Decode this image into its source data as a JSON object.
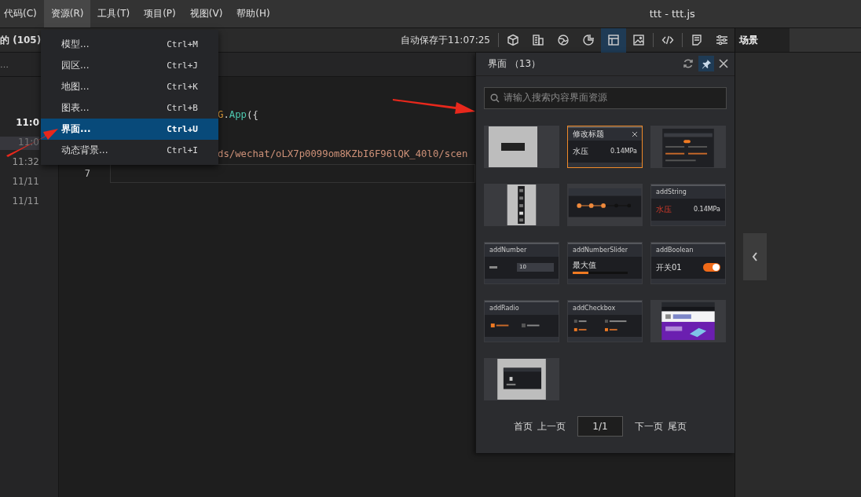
{
  "window": {
    "title": "ttt - ttt.js"
  },
  "menu_bar": [
    {
      "label": "代码(C)",
      "selected": false
    },
    {
      "label": "资源(R)",
      "selected": true
    },
    {
      "label": "工具(T)",
      "selected": false
    },
    {
      "label": "项目(P)",
      "selected": false
    },
    {
      "label": "视图(V)",
      "selected": false
    },
    {
      "label": "帮助(H)",
      "selected": false
    }
  ],
  "left_panel": {
    "title": "的 (105)",
    "placeholder": "…",
    "history": [
      {
        "time": "11:0",
        "selected": false
      },
      {
        "time": "11:0",
        "selected": true
      },
      {
        "time": "11:32",
        "selected": false
      },
      {
        "time": "11/11",
        "selected": false
      },
      {
        "time": "11/11",
        "selected": false
      }
    ]
  },
  "toolbar": {
    "autosave": "自动保存于11:07:25",
    "tools": [
      {
        "kind": "cube",
        "selected": false
      },
      {
        "kind": "building",
        "selected": false
      },
      {
        "kind": "globe",
        "selected": false
      },
      {
        "kind": "pie",
        "selected": false
      },
      {
        "kind": "layout",
        "selected": true
      },
      {
        "kind": "image",
        "selected": false
      },
      {
        "kind": "code",
        "selected": false
      },
      {
        "kind": "note",
        "selected": false
      },
      {
        "kind": "sliders",
        "selected": false
      }
    ]
  },
  "scene_tab": {
    "label": "场景"
  },
  "resource_menu": [
    {
      "label": "模型...",
      "shortcut": "Ctrl+M",
      "selected": false
    },
    {
      "label": "园区...",
      "shortcut": "Ctrl+J",
      "selected": false
    },
    {
      "label": "地图...",
      "shortcut": "Ctrl+K",
      "selected": false
    },
    {
      "label": "图表...",
      "shortcut": "Ctrl+B",
      "selected": false
    },
    {
      "label": "界面...",
      "shortcut": "Ctrl+U",
      "selected": true
    },
    {
      "label": "动态背景...",
      "shortcut": "Ctrl+I",
      "selected": false
    }
  ],
  "editor": {
    "lines": [
      {
        "parts": [
          {
            "text": "G",
            "kind": "class"
          },
          {
            "text": ".",
            "kind": "plain"
          },
          {
            "text": "App",
            "kind": "func"
          },
          {
            "text": "({",
            "kind": "plain"
          }
        ],
        "current": false
      },
      {
        "current": false
      },
      {
        "parts": [
          {
            "text": "ds/wechat/oLX7p0099om8KZbI6F96lQK_40l0/scen",
            "kind": "string"
          }
        ],
        "current": false
      },
      {
        "number": "7",
        "current": true
      }
    ]
  },
  "ui_panel": {
    "title": "界面",
    "count": "（13）",
    "pinned": true,
    "placeholder": "请输入搜索内容界面资源",
    "thumbnails": [
      {
        "kind": "button-demo",
        "selected": false
      },
      {
        "kind": "titled-value",
        "selected": true,
        "title": "修改标题",
        "label": "水压",
        "value": "0.14MPa"
      },
      {
        "kind": "settings-form",
        "selected": false
      },
      {
        "kind": "vertical-toolbar",
        "selected": false
      },
      {
        "kind": "timeline",
        "selected": false
      },
      {
        "kind": "string",
        "selected": false,
        "title": "addString",
        "label": "水压",
        "value": "0.14MPa"
      },
      {
        "kind": "number",
        "selected": false,
        "title": "addNumber",
        "value": "10"
      },
      {
        "kind": "slider",
        "selected": false,
        "title": "addNumberSlider",
        "label": "最大值",
        "level": 0.28
      },
      {
        "kind": "boolean",
        "selected": false,
        "title": "addBoolean",
        "label": "开关01",
        "on": true
      },
      {
        "kind": "radio",
        "selected": false,
        "title": "addRadio"
      },
      {
        "kind": "checkbox",
        "selected": false,
        "title": "addCheckbox"
      },
      {
        "kind": "web-page",
        "selected": false
      },
      {
        "kind": "dialog",
        "selected": false
      }
    ],
    "pagination": {
      "first": "首页",
      "prev": "上一页",
      "page": "1/1",
      "next": "下一页",
      "last": "尾页"
    }
  }
}
